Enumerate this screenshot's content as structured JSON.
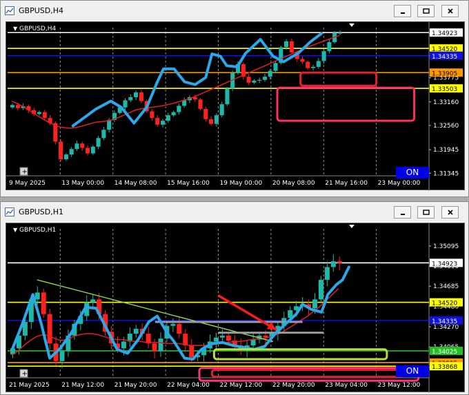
{
  "windows": [
    {
      "title": "GBPUSD,H4",
      "symbol_label": "GBPUSD,H4",
      "on_label": "ON",
      "chart_data": {
        "type": "candlestick",
        "symbol": "GBPUSD",
        "timeframe": "H4",
        "ylim": [
          1.3128,
          1.3505
        ],
        "y_ticks": [
          {
            "label": "1.3490",
            "value": 1.349
          },
          {
            "label": "1.34335",
            "value": 1.34335
          },
          {
            "label": "1.33775",
            "value": 1.33775
          },
          {
            "label": "1.33160",
            "value": 1.3316
          },
          {
            "label": "1.32560",
            "value": 1.3256
          },
          {
            "label": "1.31945",
            "value": 1.31945
          },
          {
            "label": "1.31345",
            "value": 1.31345
          }
        ],
        "x_ticks": [
          "9 May 2025",
          "13 May 00:00",
          "14 May 08:00",
          "15 May 16:00",
          "19 May 00:00",
          "20 May 08:00",
          "21 May 16:00",
          "23 May 00:00"
        ],
        "price_lines": [
          {
            "label": "1.34923",
            "value": 1.34923,
            "color": "#ffffff",
            "tag_bg": "#ffffff",
            "tag_fg": "#000000"
          },
          {
            "label": "1.34520",
            "value": 1.3452,
            "color": "#ffff00",
            "tag_bg": "#ffff00",
            "tag_fg": "#000000"
          },
          {
            "label": "1.34335",
            "value": 1.34335,
            "color": "#1010e0",
            "tag_bg": "#1010e0",
            "tag_fg": "#ffffff"
          },
          {
            "label": "1.33905",
            "value": 1.33905,
            "color": "#ff9900",
            "tag_bg": "#ff9900",
            "tag_fg": "#000000"
          },
          {
            "label": "1.33503",
            "value": 1.33503,
            "color": "#ffff00",
            "tag_bg": "#ffff00",
            "tag_fg": "#000000"
          }
        ],
        "close": [
          1.3308,
          1.33,
          1.3305,
          1.3295,
          1.3285,
          1.329,
          1.3275,
          1.3262,
          1.3215,
          1.317,
          1.3182,
          1.3196,
          1.321,
          1.3199,
          1.3185,
          1.3202,
          1.3224,
          1.3245,
          1.327,
          1.3288,
          1.3302,
          1.332,
          1.3328,
          1.334,
          1.3318,
          1.3292,
          1.3275,
          1.3258,
          1.3268,
          1.3282,
          1.329,
          1.3306,
          1.332,
          1.3328,
          1.3322,
          1.3298,
          1.3272,
          1.326,
          1.3282,
          1.331,
          1.335,
          1.339,
          1.3412,
          1.338,
          1.3365,
          1.337,
          1.3372,
          1.338,
          1.3395,
          1.3415,
          1.3455,
          1.347,
          1.3442,
          1.3425,
          1.3418,
          1.3402,
          1.3405,
          1.342,
          1.3445,
          1.3468,
          1.3492,
          1.3492
        ],
        "ma": [
          1.3318,
          1.3312,
          1.3305,
          1.3296,
          1.3288,
          1.3279,
          1.3271,
          1.3263,
          1.3257,
          1.3252,
          1.325,
          1.3249,
          1.3251,
          1.3254,
          1.3258,
          1.3262,
          1.3265,
          1.3266,
          1.3268,
          1.3272,
          1.3277,
          1.3283,
          1.3289,
          1.3295,
          1.3298,
          1.33,
          1.3302,
          1.3304,
          1.3306,
          1.3309,
          1.3312,
          1.3316,
          1.332,
          1.3324,
          1.3329,
          1.3335,
          1.3341,
          1.3347,
          1.3353,
          1.3359,
          1.3365,
          1.3371,
          1.3377,
          1.3383,
          1.3389,
          1.3395,
          1.3401,
          1.3407,
          1.3413,
          1.3419,
          1.3425,
          1.3431,
          1.3437,
          1.3443,
          1.3449,
          1.3455,
          1.346,
          1.3465,
          1.347,
          1.3475,
          1.348,
          1.3485
        ],
        "ma_color": "#e02020",
        "swing": [
          [
            0.155,
            1.3255
          ],
          [
            0.21,
            1.3298
          ],
          [
            0.245,
            1.3318
          ],
          [
            0.27,
            1.3302
          ],
          [
            0.3,
            1.3262
          ],
          [
            0.33,
            1.3302
          ],
          [
            0.355,
            1.3366
          ],
          [
            0.37,
            1.34
          ],
          [
            0.395,
            1.34
          ],
          [
            0.42,
            1.3367
          ],
          [
            0.445,
            1.336
          ],
          [
            0.47,
            1.3378
          ],
          [
            0.485,
            1.3438
          ],
          [
            0.505,
            1.3432
          ],
          [
            0.52,
            1.3408
          ],
          [
            0.545,
            1.3405
          ],
          [
            0.565,
            1.344
          ],
          [
            0.6,
            1.3475
          ],
          [
            0.63,
            1.3432
          ],
          [
            0.655,
            1.3418
          ],
          [
            0.69,
            1.344
          ],
          [
            0.72,
            1.347
          ],
          [
            0.745,
            1.349
          ]
        ],
        "swing_color": "#2aa8e8",
        "zones": [
          {
            "x0": 0.695,
            "x1": 0.875,
            "y0": 1.33905,
            "y1": 1.3357,
            "color": "#e02030"
          },
          {
            "x0": 0.64,
            "x1": 0.965,
            "y0": 1.3352,
            "y1": 1.3268,
            "color": "#ff3060"
          }
        ]
      }
    },
    {
      "title": "GBPUSD,H1",
      "symbol_label": "GBPUSD,H1",
      "on_label": "ON",
      "chart_data": {
        "type": "candlestick",
        "symbol": "GBPUSD",
        "timeframe": "H1",
        "ylim": [
          1.3375,
          1.3527
        ],
        "y_ticks": [
          {
            "label": "1.35095",
            "value": 1.35095
          },
          {
            "label": "1.34890",
            "value": 1.3489
          },
          {
            "label": "1.34685",
            "value": 1.34685
          },
          {
            "label": "1.34480",
            "value": 1.3448
          },
          {
            "label": "1.34270",
            "value": 1.3427
          },
          {
            "label": "1.34065",
            "value": 1.34065
          },
          {
            "label": "1.33855",
            "value": 1.33855
          }
        ],
        "x_ticks": [
          "21 May 2025",
          "21 May 12:00",
          "21 May 20:00",
          "22 May 04:00",
          "22 May 12:00",
          "22 May 20:00",
          "23 May 04:00",
          "23 May 12:00"
        ],
        "price_lines": [
          {
            "label": "1.34923",
            "value": 1.34923,
            "color": "#ffffff",
            "tag_bg": "#ffffff",
            "tag_fg": "#000000"
          },
          {
            "label": "1.34520",
            "value": 1.3452,
            "color": "#ffff00",
            "tag_bg": "#ffff00",
            "tag_fg": "#000000"
          },
          {
            "label": "1.34335",
            "value": 1.34335,
            "color": "#1010e0",
            "tag_bg": "#1010e0",
            "tag_fg": "#ffffff"
          },
          {
            "label": "1.34025",
            "value": 1.34025,
            "color": "#22c022",
            "tag_bg": "#22c022",
            "tag_fg": "#ffffff"
          },
          {
            "label": "1.33905",
            "value": 1.33905,
            "color": "#ff9900",
            "tag_bg": "#ff9900",
            "tag_fg": "#000000"
          },
          {
            "label": "1.33868",
            "value": 1.33868,
            "color": "#ffff00",
            "tag_bg": "#ffff00",
            "tag_fg": "#000000"
          }
        ],
        "close": [
          1.3405,
          1.3418,
          1.3432,
          1.3455,
          1.3462,
          1.344,
          1.341,
          1.3392,
          1.3402,
          1.3418,
          1.343,
          1.3438,
          1.3452,
          1.3455,
          1.344,
          1.3422,
          1.341,
          1.3405,
          1.3412,
          1.342,
          1.3425,
          1.342,
          1.341,
          1.3402,
          1.3415,
          1.3428,
          1.343,
          1.342,
          1.3408,
          1.3396,
          1.3398,
          1.3405,
          1.3412,
          1.3416,
          1.3418,
          1.3413,
          1.3408,
          1.3403,
          1.3408,
          1.3414,
          1.3418,
          1.3416,
          1.342,
          1.3428,
          1.3436,
          1.3444,
          1.3448,
          1.345,
          1.3446,
          1.3455,
          1.3475,
          1.3488,
          1.3494,
          1.3492
        ],
        "ma": [
          1.3398,
          1.3402,
          1.3408,
          1.3413,
          1.3417,
          1.3419,
          1.3418,
          1.3415,
          1.3413,
          1.3414,
          1.3417,
          1.3419,
          1.342,
          1.342,
          1.3419,
          1.3417,
          1.3415,
          1.3414,
          1.3414,
          1.3413,
          1.3412,
          1.3412,
          1.3411,
          1.3411,
          1.3411,
          1.341,
          1.341,
          1.341,
          1.3409,
          1.3408,
          1.3408,
          1.3408,
          1.3408,
          1.3409,
          1.341,
          1.3411,
          1.3412,
          1.3412,
          1.3413,
          1.3414,
          1.3415,
          1.3415,
          1.3417,
          1.3419,
          1.3422,
          1.3426,
          1.343,
          1.3434,
          1.3438,
          1.3443,
          1.3448,
          1.3454,
          1.346,
          1.3466
        ],
        "ma_color": "#e02020",
        "swing": [
          [
            0.012,
            1.3405
          ],
          [
            0.035,
            1.343
          ],
          [
            0.06,
            1.346
          ],
          [
            0.08,
            1.343
          ],
          [
            0.1,
            1.3395
          ],
          [
            0.125,
            1.3405
          ],
          [
            0.15,
            1.342
          ],
          [
            0.185,
            1.3447
          ],
          [
            0.21,
            1.3446
          ],
          [
            0.235,
            1.3425
          ],
          [
            0.26,
            1.3404
          ],
          [
            0.285,
            1.34
          ],
          [
            0.31,
            1.3414
          ],
          [
            0.335,
            1.3432
          ],
          [
            0.355,
            1.3438
          ],
          [
            0.38,
            1.342
          ],
          [
            0.395,
            1.3412
          ],
          [
            0.42,
            1.3395
          ],
          [
            0.44,
            1.3394
          ],
          [
            0.46,
            1.3404
          ],
          [
            0.485,
            1.341
          ],
          [
            0.51,
            1.3411
          ],
          [
            0.535,
            1.3408
          ],
          [
            0.56,
            1.3406
          ],
          [
            0.585,
            1.3404
          ],
          [
            0.61,
            1.3407
          ],
          [
            0.635,
            1.342
          ],
          [
            0.66,
            1.343
          ],
          [
            0.685,
            1.344
          ],
          [
            0.7,
            1.345
          ],
          [
            0.72,
            1.3445
          ],
          [
            0.745,
            1.3442
          ],
          [
            0.76,
            1.346
          ],
          [
            0.78,
            1.347
          ],
          [
            0.795,
            1.3475
          ],
          [
            0.81,
            1.3488
          ]
        ],
        "swing_color": "#2aa8e8",
        "trendline": {
          "x0": 0.07,
          "y0": 1.3475,
          "x1": 0.63,
          "y1": 1.3412,
          "color": "#88dd55"
        },
        "grey_lines": [
          {
            "x0": 0.35,
            "x1": 0.7,
            "y": 1.3432
          },
          {
            "x0": 0.5,
            "x1": 0.75,
            "y": 1.3421
          }
        ],
        "arrow": {
          "x0": 0.5,
          "y0": 1.3459,
          "x1": 0.638,
          "y1": 1.3424,
          "color": "#ff1a1a"
        },
        "zones": [
          {
            "x0": 0.49,
            "x1": 0.9,
            "y0": 1.3404,
            "y1": 1.3394,
            "color": "#b5e23a"
          },
          {
            "x0": 0.455,
            "x1": 0.975,
            "y0": 1.3385,
            "y1": 1.3372,
            "color": "#ff3080"
          },
          {
            "x0": 0.485,
            "x1": 0.935,
            "y0": 1.3383,
            "y1": 1.3376,
            "color": "#e02030"
          }
        ]
      }
    }
  ]
}
